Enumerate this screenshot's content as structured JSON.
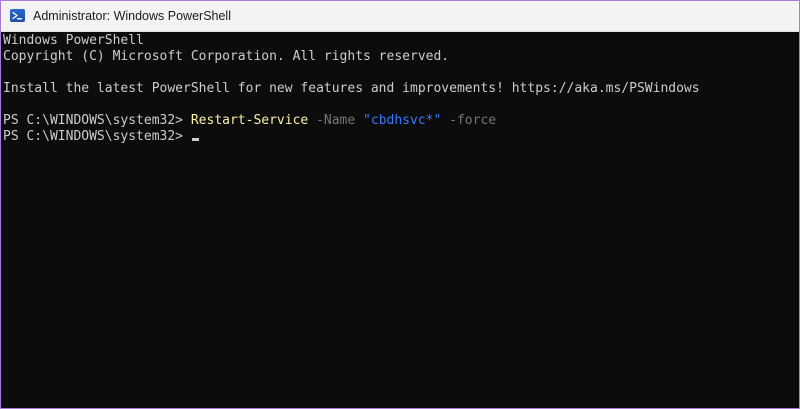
{
  "window": {
    "title": "Administrator: Windows PowerShell",
    "icon": "powershell-icon"
  },
  "console": {
    "header_line1": "Windows PowerShell",
    "header_line2": "Copyright (C) Microsoft Corporation. All rights reserved.",
    "notice": "Install the latest PowerShell for new features and improvements! https://aka.ms/PSWindows",
    "prompt": "PS C:\\WINDOWS\\system32> ",
    "command": {
      "name": "Restart-Service",
      "param": " -Name ",
      "value": "\"cbdhsvc*\"",
      "flag": " -force"
    }
  },
  "colors": {
    "background": "#0c0c0c",
    "text": "#cccccc",
    "command": "#f9f1a5",
    "parameter": "#767676",
    "string": "#3b78ff",
    "window_border": "#a77bd6"
  }
}
